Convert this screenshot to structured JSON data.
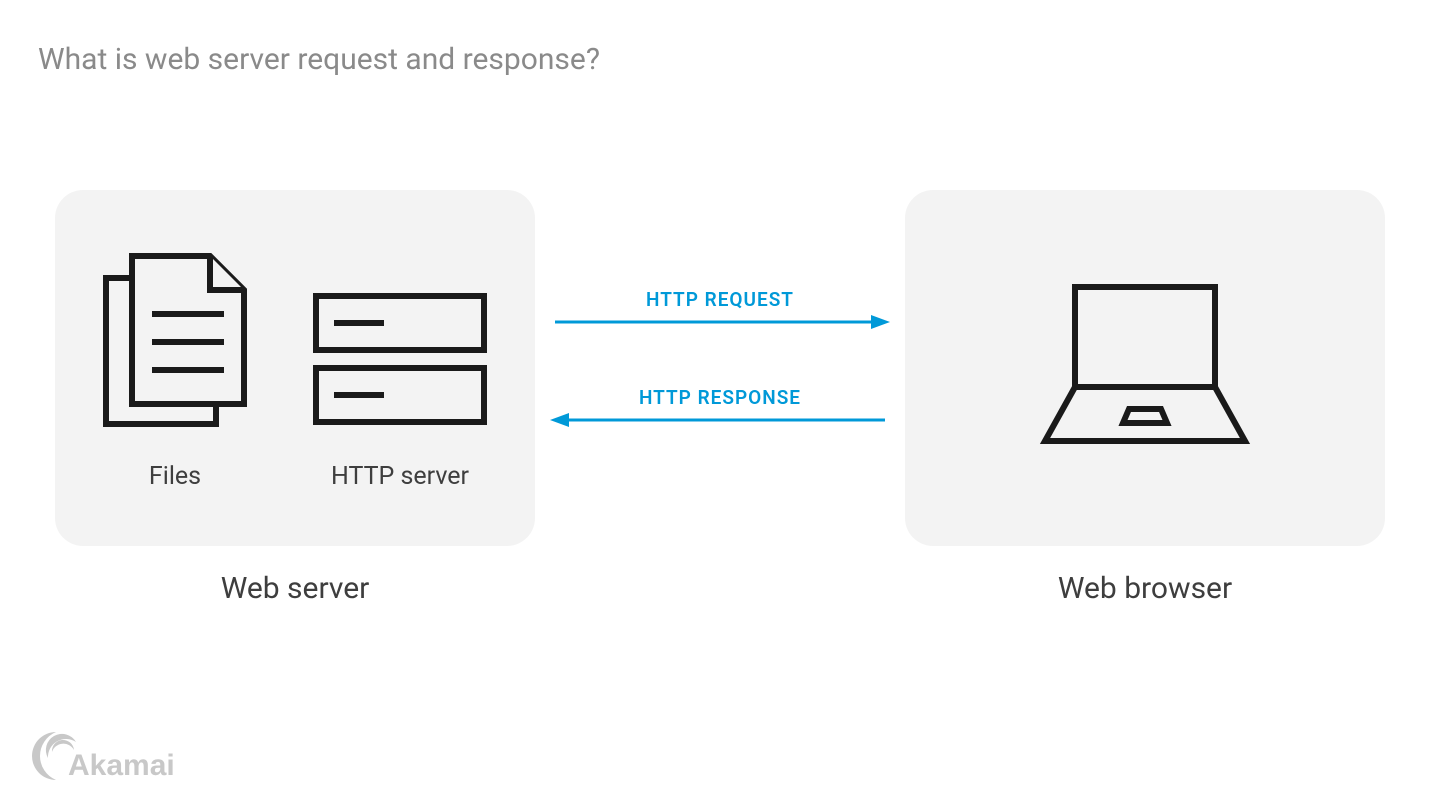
{
  "title": "What is web server request and response?",
  "left_panel": {
    "title": "Web server",
    "files_label": "Files",
    "http_server_label": "HTTP server"
  },
  "right_panel": {
    "title": "Web browser"
  },
  "arrows": {
    "request_label": "HTTP REQUEST",
    "response_label": "HTTP RESPONSE"
  },
  "brand": "Akamai",
  "colors": {
    "accent": "#0099d8",
    "icon_stroke": "#1a1a1a",
    "title_gray": "#8a8a8a",
    "panel_bg": "#f3f3f3",
    "logo_gray": "#c8c8c8"
  }
}
